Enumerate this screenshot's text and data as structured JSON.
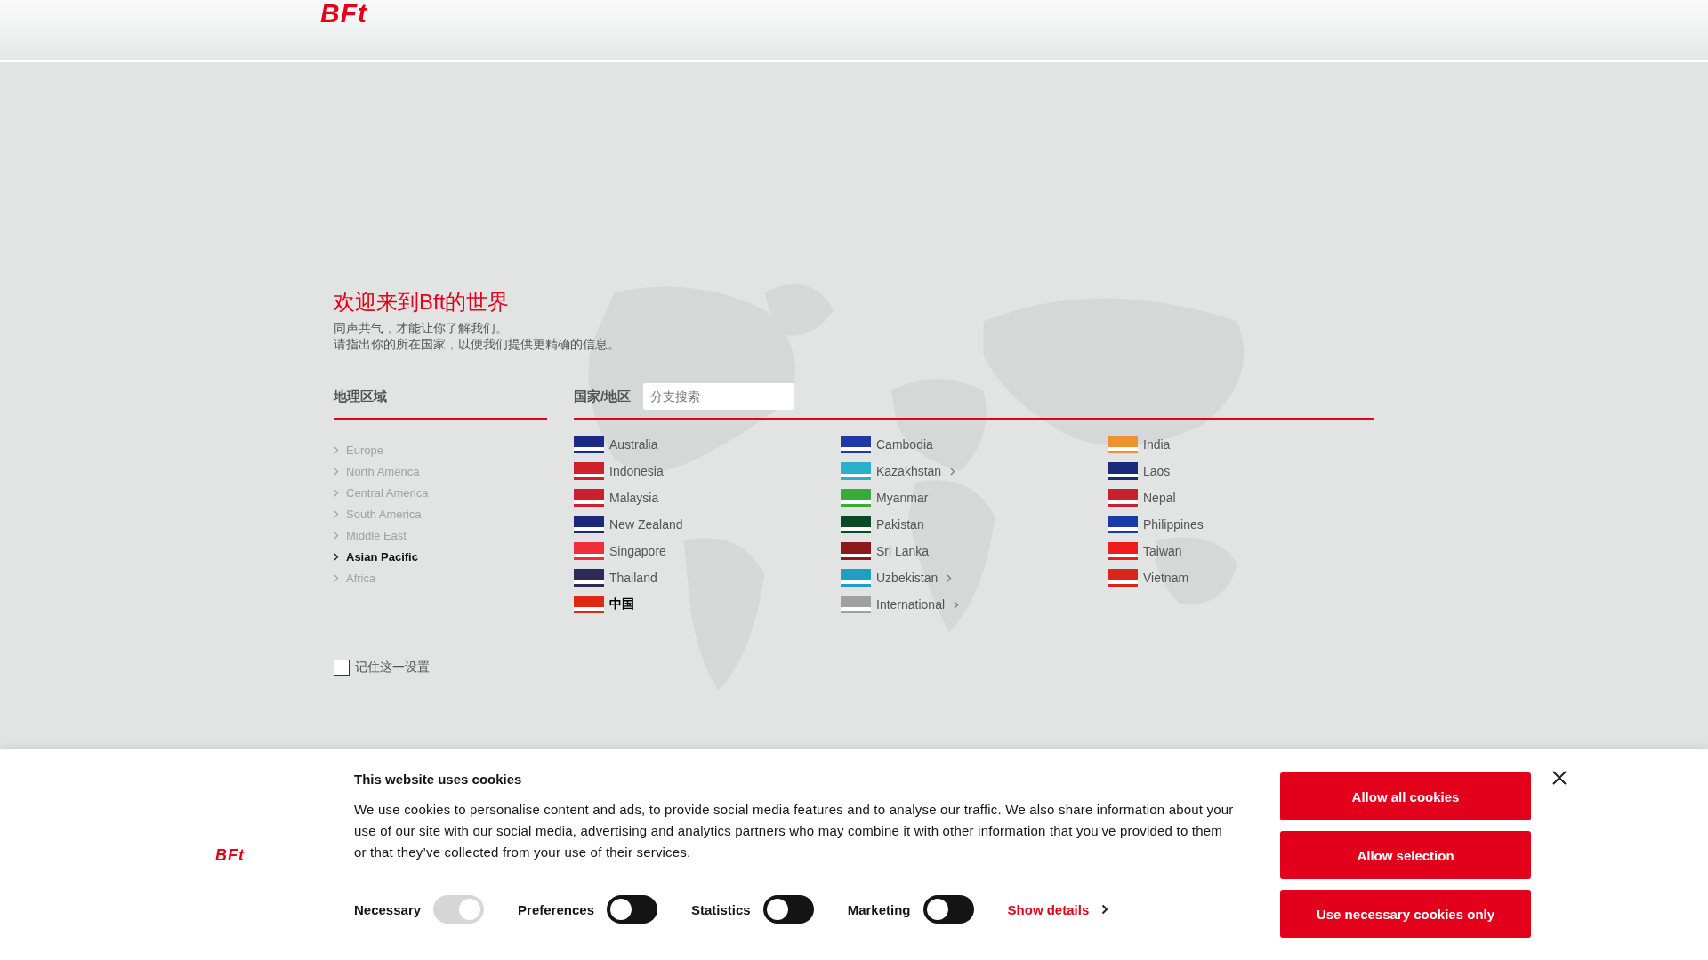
{
  "header": {
    "logo": "BFt"
  },
  "intro": {
    "title": "欢迎来到Bft的世界",
    "lines": [
      "同声共气，才能让你了解我们。",
      "请指出你的所在国家，以便我们提供更精确的信息。"
    ]
  },
  "regions": {
    "heading": "地理区域",
    "items": [
      {
        "label": "Europe",
        "selected": false
      },
      {
        "label": "North America",
        "selected": false
      },
      {
        "label": "Central America",
        "selected": false
      },
      {
        "label": "South America",
        "selected": false
      },
      {
        "label": "Middle East",
        "selected": false
      },
      {
        "label": "Asian Pacific",
        "selected": true
      },
      {
        "label": "Africa",
        "selected": false
      }
    ]
  },
  "countries": {
    "heading": "国家/地区",
    "search": {
      "placeholder": "分支搜索"
    },
    "columns": [
      [
        {
          "label": "Australia",
          "color": "#1a2a8a",
          "submenu": false,
          "selected": false
        },
        {
          "label": "Indonesia",
          "color": "#d21f2c",
          "submenu": false,
          "selected": false
        },
        {
          "label": "Malaysia",
          "color": "#cc1f2f",
          "submenu": false,
          "selected": false
        },
        {
          "label": "New Zealand",
          "color": "#1a2a7a",
          "submenu": false,
          "selected": false
        },
        {
          "label": "Singapore",
          "color": "#ee2e3a",
          "submenu": false,
          "selected": false
        },
        {
          "label": "Thailand",
          "color": "#2d2a5a",
          "submenu": false,
          "selected": false
        },
        {
          "label": "中国",
          "color": "#de2910",
          "submenu": false,
          "selected": true
        }
      ],
      [
        {
          "label": "Cambodia",
          "color": "#1f3aa8",
          "submenu": false,
          "selected": false
        },
        {
          "label": "Kazakhstan",
          "color": "#2ab0c8",
          "submenu": true,
          "selected": false
        },
        {
          "label": "Myanmar",
          "color": "#3aab3a",
          "submenu": false,
          "selected": false
        },
        {
          "label": "Pakistan",
          "color": "#0b4a22",
          "submenu": false,
          "selected": false
        },
        {
          "label": "Sri Lanka",
          "color": "#8c1a1a",
          "submenu": false,
          "selected": false
        },
        {
          "label": "Uzbekistan",
          "color": "#1ea0c0",
          "submenu": true,
          "selected": false
        },
        {
          "label": "International",
          "color": "#a0a0a0",
          "submenu": true,
          "selected": false
        }
      ],
      [
        {
          "label": "India",
          "color": "#f09030",
          "submenu": false,
          "selected": false
        },
        {
          "label": "Laos",
          "color": "#1a2a7a",
          "submenu": false,
          "selected": false
        },
        {
          "label": "Nepal",
          "color": "#c8202e",
          "submenu": false,
          "selected": false
        },
        {
          "label": "Philippines",
          "color": "#1a3aa8",
          "submenu": false,
          "selected": false
        },
        {
          "label": "Taiwan",
          "color": "#ee1c1c",
          "submenu": false,
          "selected": false
        },
        {
          "label": "Vietnam",
          "color": "#da251d",
          "submenu": false,
          "selected": false
        }
      ]
    ]
  },
  "remember": {
    "label": "记住这一设置",
    "checked": false
  },
  "cookie_banner": {
    "logo": "BFt",
    "title": "This website uses cookies",
    "text": "We use cookies to personalise content and ads, to provide social media features and to analyse our traffic. We also share information about your use of our site with our social media, advertising and analytics partners who may combine it with other information that you’ve provided to them or that they’ve collected from your use of their services.",
    "toggles": [
      {
        "label": "Necessary",
        "on": true,
        "disabled": true
      },
      {
        "label": "Preferences",
        "on": false,
        "disabled": false
      },
      {
        "label": "Statistics",
        "on": false,
        "disabled": false
      },
      {
        "label": "Marketing",
        "on": false,
        "disabled": false
      }
    ],
    "details_link": "Show details",
    "buttons": [
      "Allow all cookies",
      "Allow selection",
      "Use necessary cookies only"
    ]
  }
}
